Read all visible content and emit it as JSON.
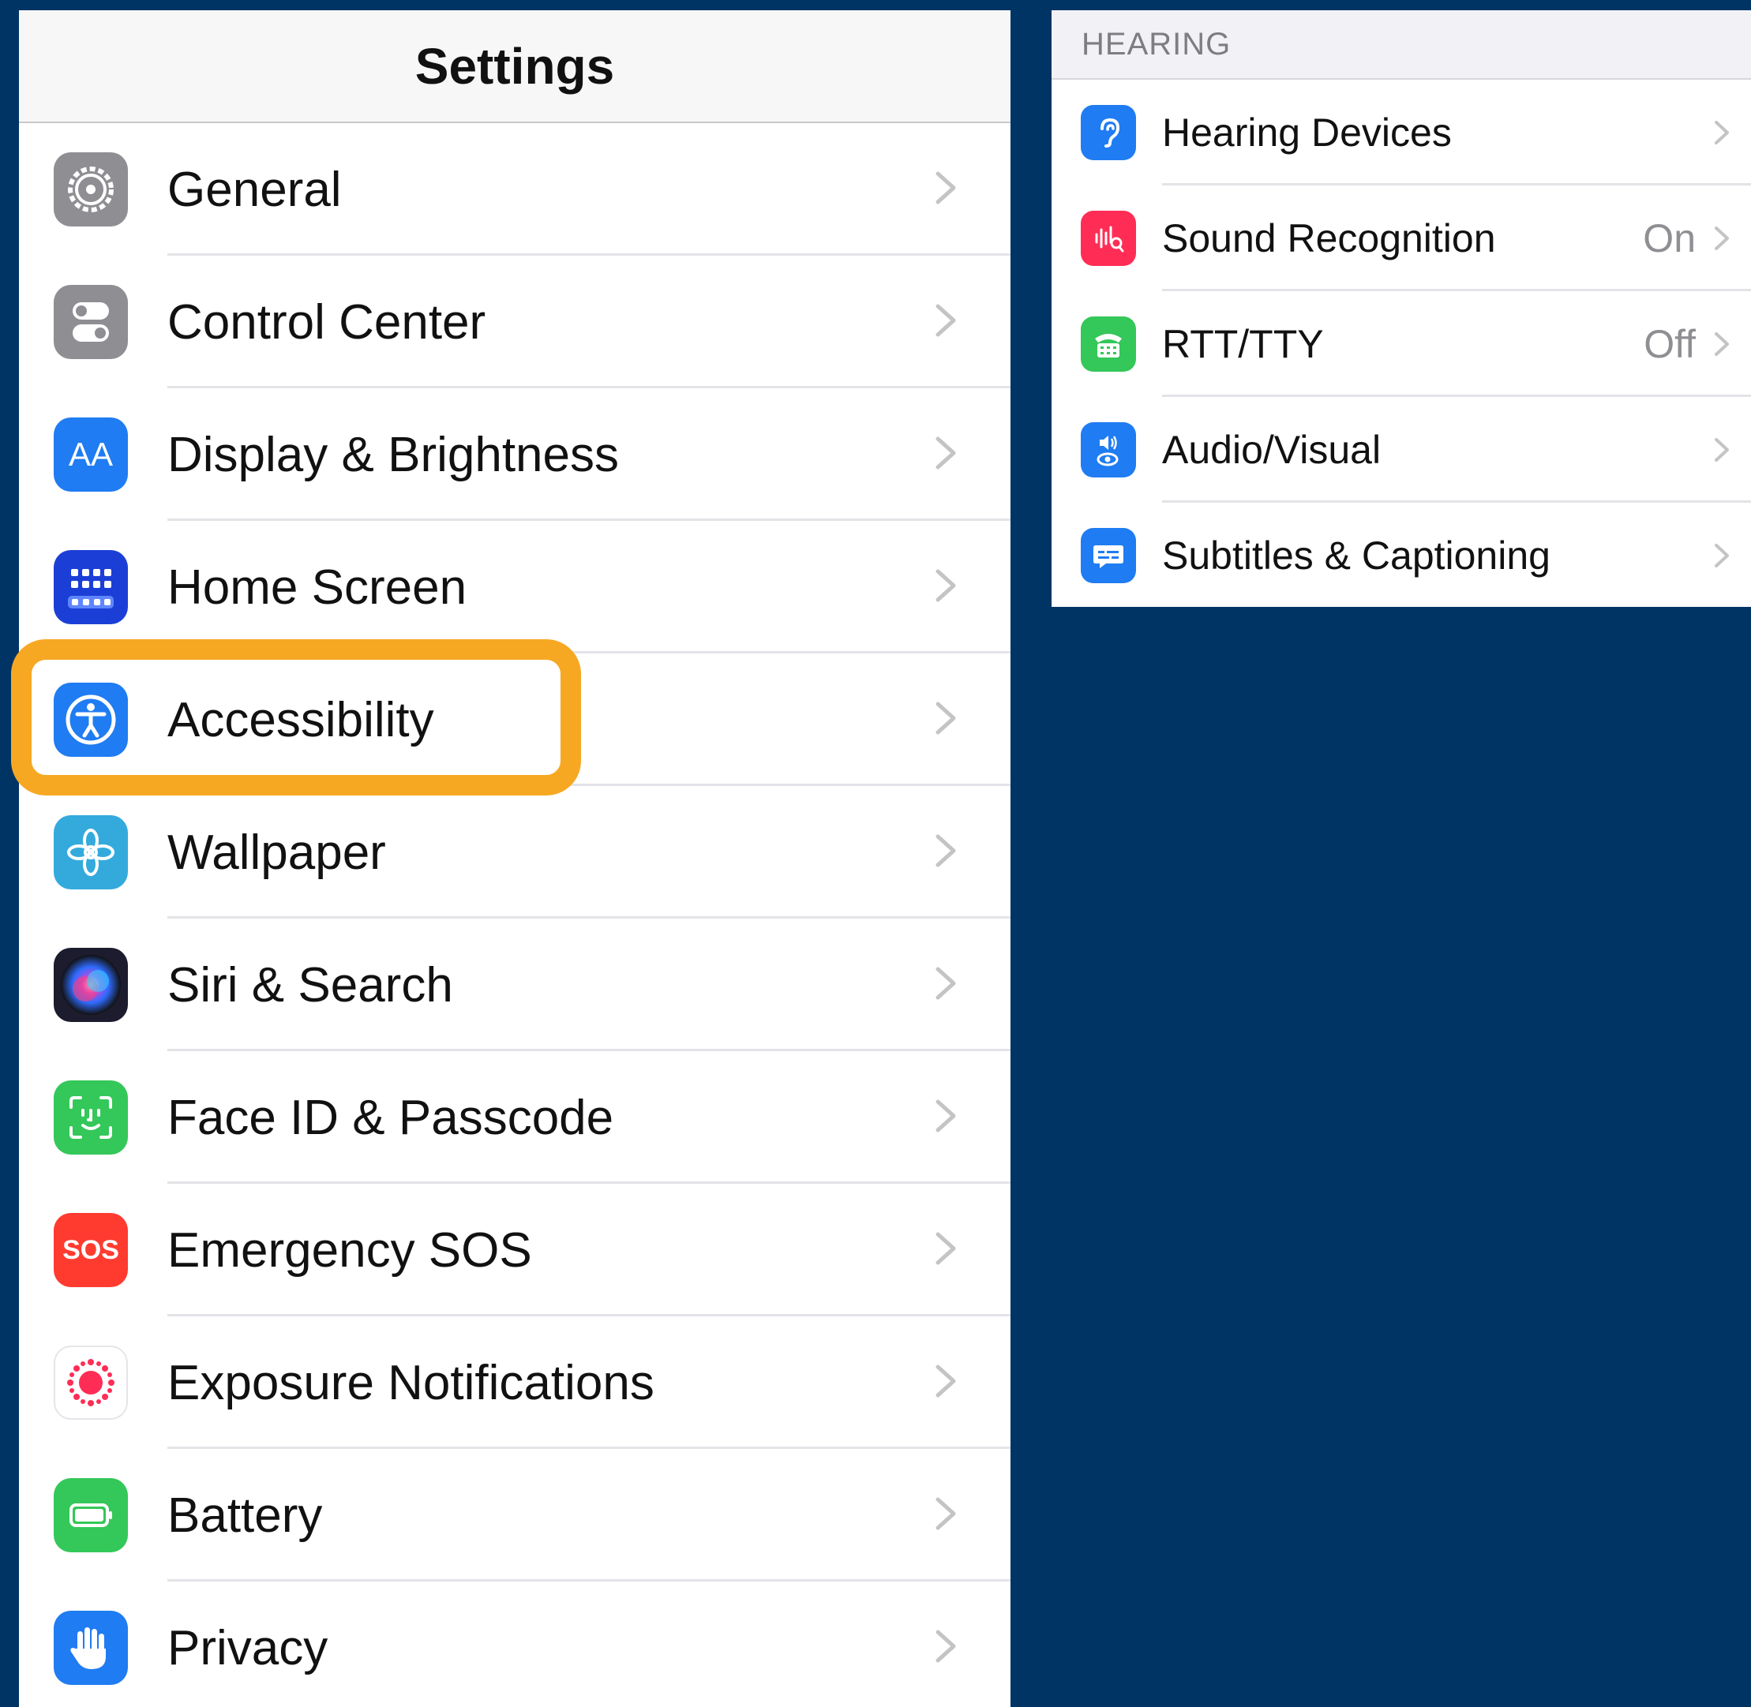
{
  "settings": {
    "title": "Settings",
    "items": [
      {
        "label": "General",
        "icon": "gear-icon",
        "color": "#8e8e93"
      },
      {
        "label": "Control Center",
        "icon": "switches-icon",
        "color": "#8e8e93"
      },
      {
        "label": "Display & Brightness",
        "icon": "text-size-icon",
        "color": "#1f7cf2",
        "icon_text": "AA"
      },
      {
        "label": "Home Screen",
        "icon": "app-grid-icon",
        "color": "#1b3fd6"
      },
      {
        "label": "Accessibility",
        "icon": "accessibility-icon",
        "color": "#1f7cf2"
      },
      {
        "label": "Wallpaper",
        "icon": "flower-icon",
        "color": "#34aadc"
      },
      {
        "label": "Siri & Search",
        "icon": "siri-icon",
        "color": "#1c1c2e"
      },
      {
        "label": "Face ID & Passcode",
        "icon": "face-id-icon",
        "color": "#34c759"
      },
      {
        "label": "Emergency SOS",
        "icon": "sos-icon",
        "color": "#ff3b30",
        "icon_text": "SOS"
      },
      {
        "label": "Exposure Notifications",
        "icon": "exposure-icon",
        "color": "#ffffff"
      },
      {
        "label": "Battery",
        "icon": "battery-icon",
        "color": "#34c759"
      },
      {
        "label": "Privacy",
        "icon": "hand-icon",
        "color": "#1f7cf2"
      }
    ],
    "highlight_color": "#f7a823"
  },
  "hearing": {
    "section_header": "HEARING",
    "items": [
      {
        "label": "Hearing Devices",
        "value": "",
        "icon": "ear-icon",
        "color": "#1f7cf2"
      },
      {
        "label": "Sound Recognition",
        "value": "On",
        "icon": "sound-recognition-icon",
        "color": "#ff2d55"
      },
      {
        "label": "RTT/TTY",
        "value": "Off",
        "icon": "tty-icon",
        "color": "#34c759"
      },
      {
        "label": "Audio/Visual",
        "value": "",
        "icon": "audio-visual-icon",
        "color": "#1f7cf2"
      },
      {
        "label": "Subtitles & Captioning",
        "value": "",
        "icon": "captions-icon",
        "color": "#1f7cf2"
      }
    ]
  },
  "background_color": "#003464"
}
